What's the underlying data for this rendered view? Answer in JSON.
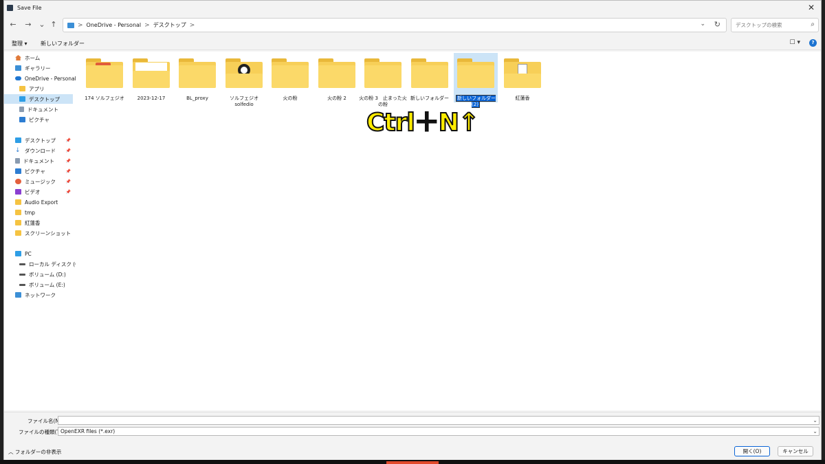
{
  "window": {
    "title": "Save File",
    "close_glyph": "✕"
  },
  "nav": {
    "back_glyph": "←",
    "forward_glyph": "→",
    "recent_glyph": "⌄",
    "up_glyph": "↑",
    "breadcrumb": [
      "OneDrive - Personal",
      "デスクトップ"
    ],
    "separator": ">",
    "dropdown_glyph": "⌄",
    "refresh_glyph": "↻"
  },
  "search": {
    "placeholder": "デスクトップの検索",
    "icon": "search-icon",
    "glyph": "⌕"
  },
  "toolbar": {
    "organize_label": "整理 ▾",
    "new_folder_label": "新しいフォルダー",
    "view_glyph": "☐ ▾",
    "help_glyph": "?"
  },
  "sidebar": {
    "quick": [
      {
        "label": "ホーム",
        "icon": "home-icon"
      },
      {
        "label": "ギャラリー",
        "icon": "gallery-icon"
      },
      {
        "label": "OneDrive - Personal",
        "icon": "cloud-icon"
      },
      {
        "label": "アプリ",
        "icon": "folder-icon"
      },
      {
        "label": "デスクトップ",
        "icon": "desktop-icon",
        "selected": true
      },
      {
        "label": "ドキュメント",
        "icon": "document-icon"
      },
      {
        "label": "ピクチャ",
        "icon": "pictures-icon"
      }
    ],
    "pinned": [
      {
        "label": "デスクトップ",
        "icon": "desktop-icon",
        "pinned": true
      },
      {
        "label": "ダウンロード",
        "icon": "download-icon",
        "pinned": true
      },
      {
        "label": "ドキュメント",
        "icon": "document-icon",
        "pinned": true
      },
      {
        "label": "ピクチャ",
        "icon": "pictures-icon",
        "pinned": true
      },
      {
        "label": "ミュージック",
        "icon": "music-icon",
        "pinned": true
      },
      {
        "label": "ビデオ",
        "icon": "video-icon",
        "pinned": true
      },
      {
        "label": "Audio Export",
        "icon": "folder-icon"
      },
      {
        "label": "tmp",
        "icon": "folder-icon"
      },
      {
        "label": "紅蓮香",
        "icon": "folder-icon"
      },
      {
        "label": "スクリーンショット",
        "icon": "folder-icon"
      }
    ],
    "devices": [
      {
        "label": "PC",
        "icon": "pc-icon"
      },
      {
        "label": "ローカル ディスク (C:)",
        "icon": "drive-icon"
      },
      {
        "label": "ボリューム (D:)",
        "icon": "drive-icon"
      },
      {
        "label": "ボリューム (E:)",
        "icon": "drive-icon"
      },
      {
        "label": "ネットワーク",
        "icon": "network-icon"
      }
    ],
    "pin_glyph": "📌"
  },
  "files": [
    {
      "label": "174 ソルフェジオ",
      "variant": "redbook"
    },
    {
      "label": "2023-12-17",
      "variant": "paper"
    },
    {
      "label": "BL_proxy",
      "variant": "plain"
    },
    {
      "label": "ソルフェジオ solfedio",
      "variant": "mark"
    },
    {
      "label": "火の粉",
      "variant": "plain"
    },
    {
      "label": "火の粉 2",
      "variant": "plain"
    },
    {
      "label": "火の粉 3　止まった火の粉",
      "variant": "plain"
    },
    {
      "label": "新しいフォルダー",
      "variant": "plain"
    },
    {
      "label": "新しいフォルダー (2)",
      "variant": "plain",
      "selected": true,
      "renaming": true
    },
    {
      "label": "紅蓮香",
      "variant": "doc"
    }
  ],
  "overlay": {
    "text": "Ctrl＋N↑"
  },
  "footer": {
    "filename_label": "ファイル名(N):",
    "filename_value": "",
    "filetype_label": "ファイルの種類(T):",
    "filetype_value": "OpenEXR files (*.exr)",
    "hide_folders_label": "︿ フォルダーの非表示",
    "open_button": "開く(O)",
    "cancel_button": "キャンセル"
  }
}
